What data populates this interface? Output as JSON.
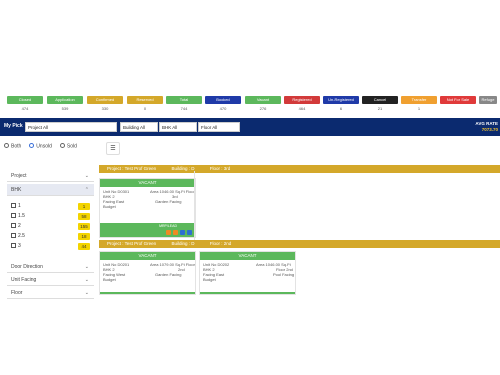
{
  "statuses": [
    {
      "label": "Closed",
      "count": "474",
      "color": "#5cb85c"
    },
    {
      "label": "Application",
      "count": "539",
      "color": "#5cb85c"
    },
    {
      "label": "Confirmed",
      "count": "330",
      "color": "#d4a82a"
    },
    {
      "label": "Reserved",
      "count": "0",
      "color": "#d4a82a"
    },
    {
      "label": "Total",
      "count": "744",
      "color": "#5cb85c"
    },
    {
      "label": "Booked",
      "count": "470",
      "color": "#1f3aa8"
    },
    {
      "label": "Vacant",
      "count": "276",
      "color": "#5cb85c"
    },
    {
      "label": "Registered",
      "count": "464",
      "color": "#d23a3a"
    },
    {
      "label": "Un-Registered",
      "count": "6",
      "color": "#1f3aa8"
    },
    {
      "label": "Cancel",
      "count": "21",
      "color": "#222222"
    },
    {
      "label": "Transfer",
      "count": "1",
      "color": "#f0a030"
    },
    {
      "label": "Not For Sale",
      "count": "",
      "color": "#e03a3a"
    },
    {
      "label": "Refuge",
      "count": "",
      "color": "#888888"
    }
  ],
  "filter_bar": {
    "my_pick_label": "My Pick",
    "project": "Project All",
    "building": "Building All",
    "bhk": "BHK All",
    "floor": "Floor All",
    "avg_rate_label": "AVG RATE",
    "avg_rate_value": "7073.70"
  },
  "radios": {
    "both": "Both",
    "unsold": "Unsold",
    "sold": "Sold"
  },
  "sidebar": {
    "project_label": "Project",
    "bhk_label": "BHK",
    "bhk_options": [
      {
        "label": "1",
        "count": "1"
      },
      {
        "label": "1.5",
        "count": "58"
      },
      {
        "label": "2",
        "count": "155"
      },
      {
        "label": "2.5",
        "count": "18"
      },
      {
        "label": "3",
        "count": "44"
      }
    ],
    "door_direction_label": "Door Direction",
    "unit_facing_label": "Unit Facing",
    "floor_label": "Floor"
  },
  "menu_icon": "hamburger-icon",
  "groups": [
    {
      "project": "Project : Test Prof Green",
      "building": "Building : D",
      "floor": "Floor : 3rd"
    },
    {
      "project": "Project : Test Prof Green",
      "building": "Building : D",
      "floor": "Floor : 2nd"
    }
  ],
  "cards": [
    {
      "status": "VACANT",
      "unit_no": "Unit No D0301",
      "area": "Area 1046.00 Sq.Ft Floor",
      "bhk": "BHK 2",
      "floor": "3rd",
      "facing": "Facing East",
      "garden": "Garden Facing",
      "budget": "Budget",
      "footer": "MRP/LEAD"
    },
    {
      "status": "VACANT",
      "unit_no": "Unit No D0201",
      "area": "Area 1079.00 Sq.Ft Floor",
      "bhk": "BHK 2",
      "floor": "2nd",
      "facing": "Facing West",
      "garden": "Garden Facing",
      "budget": "Budget"
    },
    {
      "status": "VACANT",
      "unit_no": "Unit No D0202",
      "area": "Area 1046.00 Sq.Ft",
      "bhk": "BHK 2",
      "floor": "Floor 2nd",
      "facing": "Facing East",
      "garden": "Pool Facing",
      "budget": "Budget"
    }
  ]
}
